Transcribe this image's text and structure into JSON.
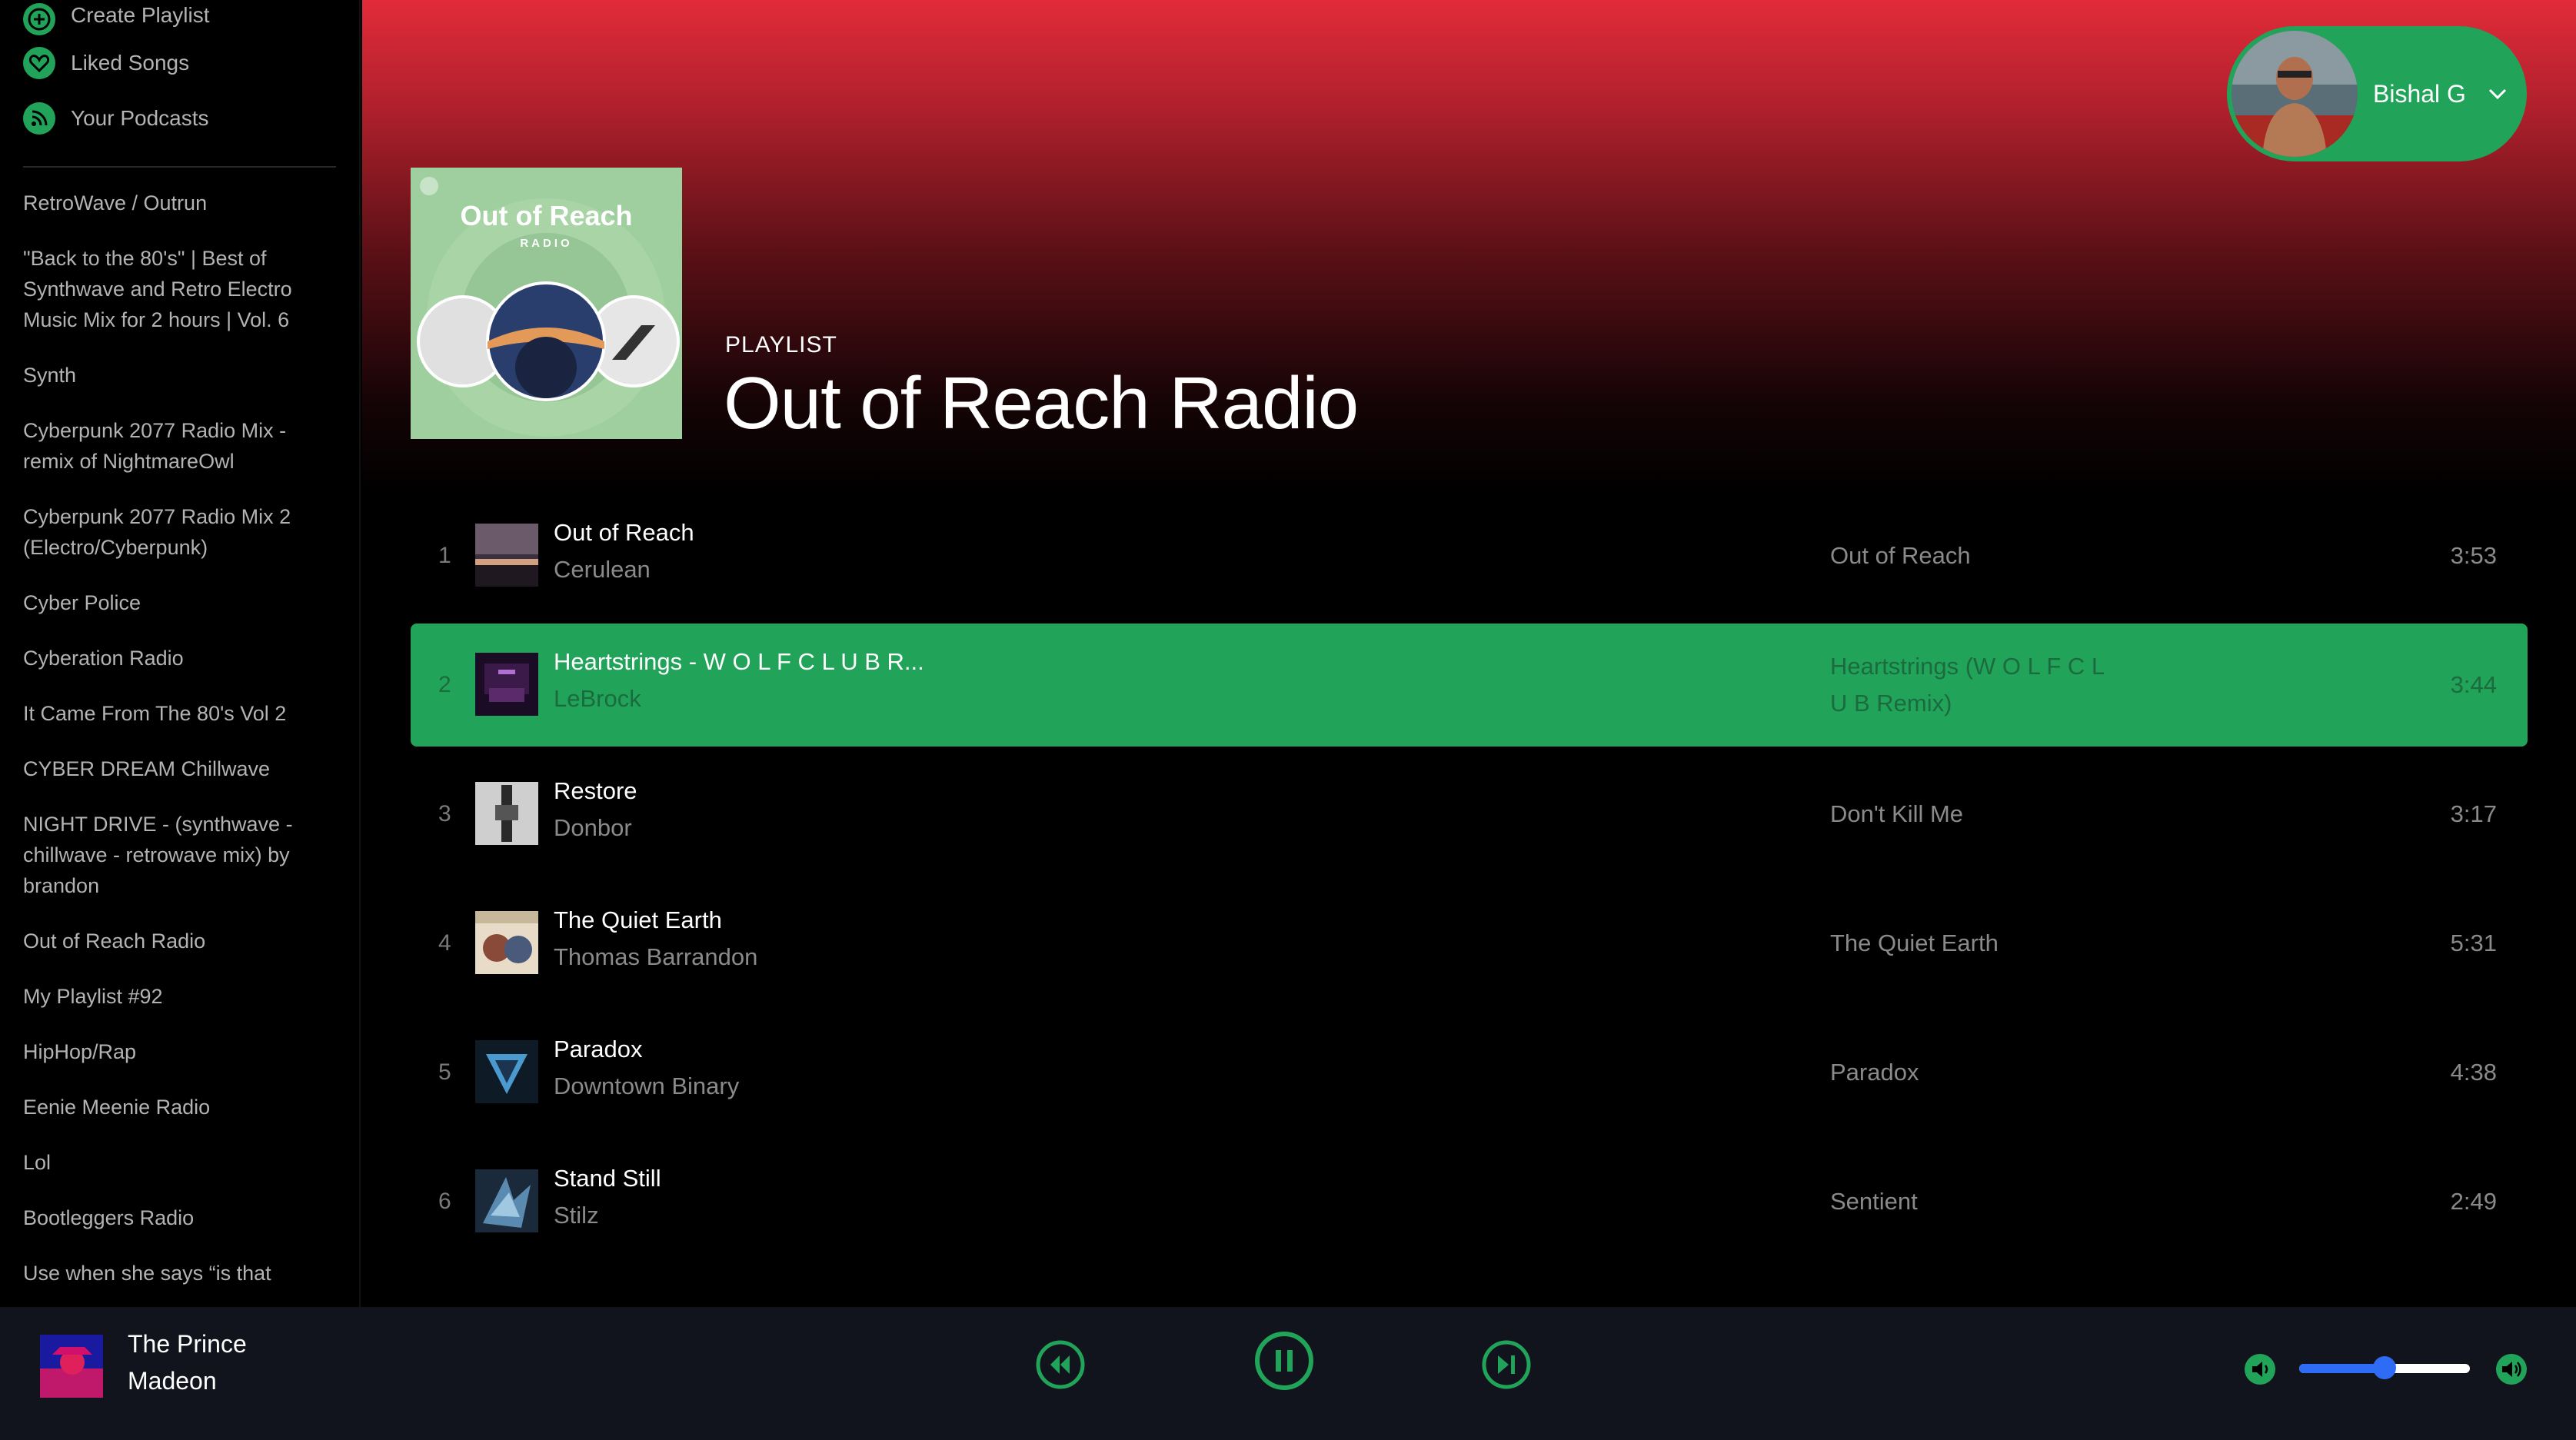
{
  "sidebar": {
    "nav": [
      {
        "label": "Create Playlist",
        "icon": "plus-circle-icon"
      },
      {
        "label": "Liked Songs",
        "icon": "heart-icon"
      },
      {
        "label": "Your Podcasts",
        "icon": "rss-icon"
      }
    ],
    "playlists": [
      "RetroWave / Outrun",
      "\"Back to the 80's\" | Best of Synthwave and Retro Electro Music Mix for 2 hours | Vol. 6",
      "Synth",
      "Cyberpunk 2077 Radio Mix - remix of NightmareOwl",
      "Cyberpunk 2077 Radio Mix 2 (Electro/Cyberpunk)",
      "Cyber Police",
      "Cyberation Radio",
      "It Came From The 80's Vol 2",
      "CYBER DREAM Chillwave",
      "NIGHT DRIVE - (synthwave - chillwave - retrowave mix) by brandon",
      "Out of Reach Radio",
      "My Playlist #92",
      "HipHop/Rap",
      "Eenie Meenie Radio",
      "Lol",
      "Bootleggers Radio",
      "Use when she says “is that"
    ]
  },
  "user": {
    "name": "Bishal G"
  },
  "playlist": {
    "type": "PLAYLIST",
    "title": "Out of Reach Radio",
    "cover_title": "Out of Reach",
    "cover_subtitle": "RADIO"
  },
  "tracks": [
    {
      "num": "1",
      "name": "Out of Reach",
      "artist": "Cerulean",
      "album": "Out of Reach",
      "duration": "3:53",
      "active": false
    },
    {
      "num": "2",
      "name": "Heartstrings - W O L F C L U B R...",
      "artist": "LeBrock",
      "album": "Heartstrings (W O L F C L U B Remix)",
      "duration": "3:44",
      "active": true
    },
    {
      "num": "3",
      "name": "Restore",
      "artist": "Donbor",
      "album": "Don't Kill Me",
      "duration": "3:17",
      "active": false
    },
    {
      "num": "4",
      "name": "The Quiet Earth",
      "artist": "Thomas Barrandon",
      "album": "The Quiet Earth",
      "duration": "5:31",
      "active": false
    },
    {
      "num": "5",
      "name": "Paradox",
      "artist": "Downtown Binary",
      "album": "Paradox",
      "duration": "4:38",
      "active": false
    },
    {
      "num": "6",
      "name": "Stand Still",
      "artist": "Stilz",
      "album": "Sentient",
      "duration": "2:49",
      "active": false
    }
  ],
  "now_playing": {
    "title": "The Prince",
    "artist": "Madeon"
  },
  "controls": {
    "volume_fraction": 0.5
  },
  "colors": {
    "accent": "#21a45a",
    "header_red": "#e22b3a",
    "slider_blue": "#2f6cf5"
  }
}
